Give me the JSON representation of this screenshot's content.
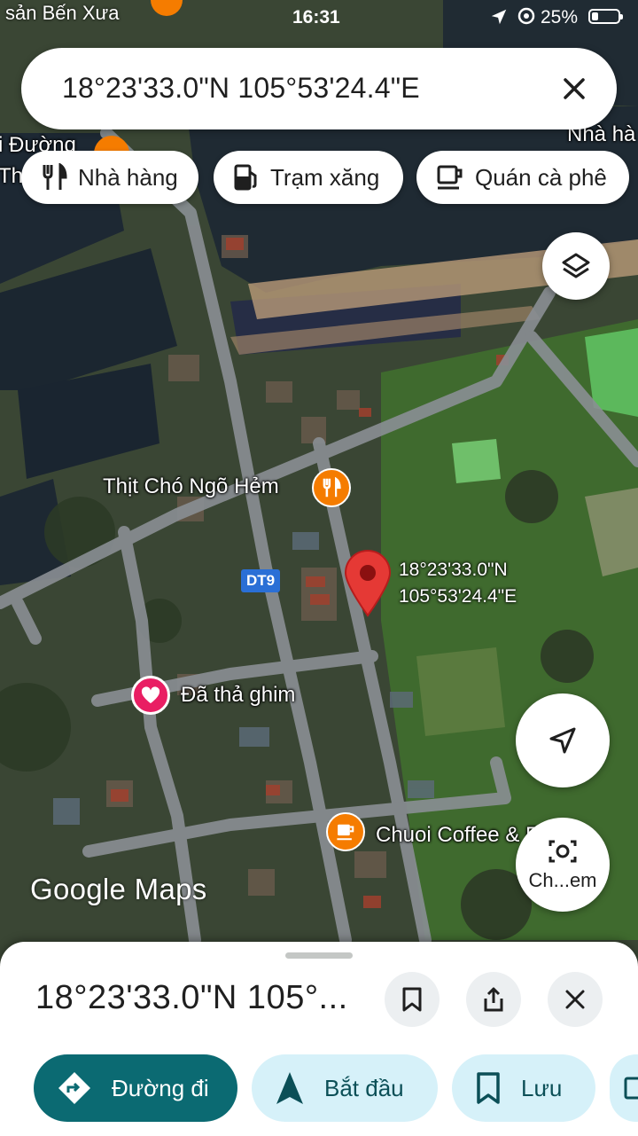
{
  "status_bar": {
    "time": "16:31",
    "battery": "25%",
    "clipped_top_label": "sản Bến Xưa"
  },
  "search": {
    "query": "18°23'33.0\"N 105°53'24.4\"E"
  },
  "chips": [
    {
      "label": "Nhà hàng",
      "icon": "restaurant-icon"
    },
    {
      "label": "Trạm xăng",
      "icon": "gas-station-icon"
    },
    {
      "label": "Quán cà phê",
      "icon": "coffee-icon"
    }
  ],
  "map": {
    "edge_labels": {
      "left": "i Đường",
      "left2": "Th",
      "right": "Nhà hà"
    },
    "poi_restaurant": "Thịt Chó Ngõ Hẻm",
    "pin_label_line1": "18°23'33.0\"N",
    "pin_label_line2": "105°53'24.4\"E",
    "road_badge": "DT9",
    "dropped_pin": "Đã thả ghim",
    "poi_coffee": "Chuoi Coffee & Food",
    "watermark": "Google Maps",
    "lens_label": "Ch...em",
    "colors": {
      "pin": "#e53935",
      "poi": "#f57c00",
      "dropped": "#e91e63"
    }
  },
  "sheet": {
    "title": "18°23'33.0\"N 105°...",
    "actions": [
      {
        "label": "Đường đi",
        "icon": "directions-icon"
      },
      {
        "label": "Bắt đầu",
        "icon": "navigation-arrow-icon"
      },
      {
        "label": "Lưu",
        "icon": "bookmark-icon"
      }
    ],
    "colors": {
      "primary": "#0b6a72",
      "secondary": "#d6f1f9"
    }
  }
}
